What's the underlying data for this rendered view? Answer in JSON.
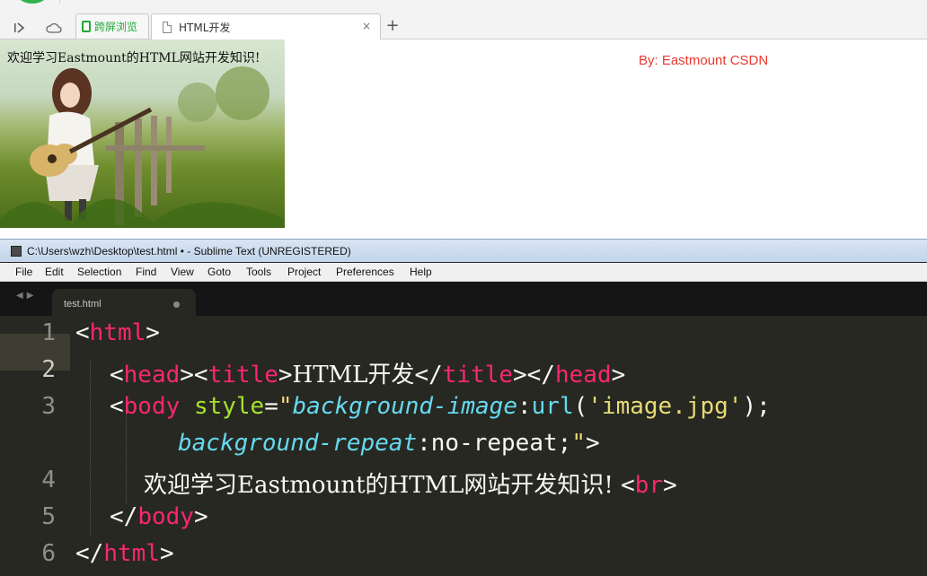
{
  "browser": {
    "tabs": [
      {
        "label": "跨屏浏览",
        "active": false
      },
      {
        "label": "HTML开发",
        "active": true
      }
    ],
    "close_glyph": "×",
    "newtab_glyph": "+",
    "back_glyph": "|>",
    "page": {
      "welcome": "欢迎学习Eastmount的HTML网站开发知识!",
      "byline": "By: Eastmount CSDN"
    }
  },
  "sublime": {
    "title": "C:\\Users\\wzh\\Desktop\\test.html • - Sublime Text (UNREGISTERED)",
    "menu": [
      "File",
      "Edit",
      "Selection",
      "Find",
      "View",
      "Goto",
      "Tools",
      "Project",
      "Preferences",
      "Help"
    ],
    "tab": "test.html",
    "line_numbers": [
      "1",
      "2",
      "3",
      "4",
      "5",
      "6"
    ],
    "current_line": 2,
    "code": {
      "l1_tag": "html",
      "l2_head": "head",
      "l2_title": "title",
      "l2_text": "HTML开发",
      "l3_tag": "body",
      "l3_attr": "style",
      "l3_prop1": "background-image",
      "l3_fn": "url",
      "l3_str": "'image.jpg'",
      "l3_prop2": "background-repeat",
      "l3_val2": "no-repeat",
      "l4_text": "欢迎学习Eastmount的HTML网站开发知识! ",
      "l4_br": "br",
      "l5_tag": "body",
      "l6_tag": "html"
    }
  },
  "colors": {
    "byline": "#e8382e",
    "editor_bg": "#272822",
    "tag": "#f92672",
    "attr": "#a6e22e",
    "string": "#e6db74",
    "property": "#66d9ef"
  }
}
